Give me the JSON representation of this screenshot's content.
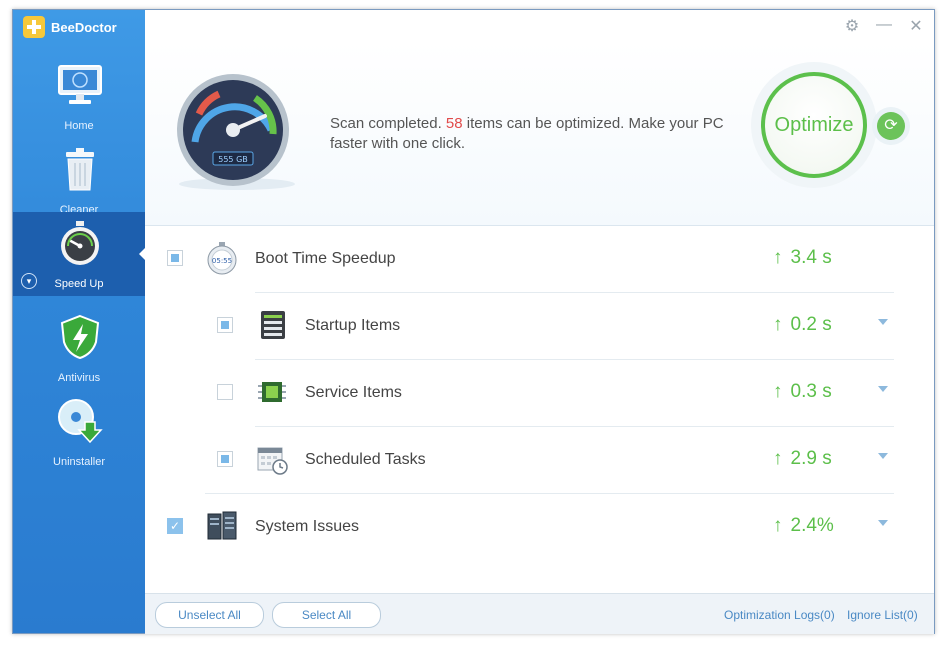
{
  "app": {
    "title": "BeeDoctor"
  },
  "titlebar": {
    "settings_icon": "gear-icon",
    "minimize_icon": "minimize-icon",
    "close_icon": "close-icon"
  },
  "sidebar": {
    "items": [
      {
        "label": "Home",
        "icon": "monitor-icon",
        "active": false
      },
      {
        "label": "Cleaner",
        "icon": "trash-icon",
        "active": false
      },
      {
        "label": "Speed Up",
        "icon": "stopwatch-icon",
        "active": true
      },
      {
        "label": "Antivirus",
        "icon": "shield-icon",
        "active": false
      },
      {
        "label": "Uninstaller",
        "icon": "disc-download-icon",
        "active": false
      }
    ]
  },
  "hero": {
    "gauge_label": "555 GB",
    "message_before": "Scan completed. ",
    "count": "58",
    "message_after": " items can be optimized. Make your PC faster with one click.",
    "optimize_label": "Optimize"
  },
  "rows": [
    {
      "label": "Boot Time Speedup",
      "value": "3.4 s",
      "check": "partial",
      "icon": "stopwatch-icon",
      "level": 0,
      "caret": false
    },
    {
      "label": "Startup Items",
      "value": "0.2 s",
      "check": "partial",
      "icon": "startup-list-icon",
      "level": 1,
      "caret": true
    },
    {
      "label": "Service Items",
      "value": "0.3 s",
      "check": "none",
      "icon": "chip-icon",
      "level": 1,
      "caret": true
    },
    {
      "label": "Scheduled Tasks",
      "value": "2.9 s",
      "check": "partial",
      "icon": "calendar-clock-icon",
      "level": 1,
      "caret": true
    },
    {
      "label": "System Issues",
      "value": "2.4%",
      "check": "checked",
      "icon": "server-icon",
      "level": 0,
      "caret": true
    }
  ],
  "footer": {
    "unselect_all": "Unselect All",
    "select_all": "Select All",
    "optimization_logs": "Optimization Logs(0)",
    "ignore_list": "Ignore List(0)"
  },
  "colors": {
    "accent": "#5cbf4a",
    "sidebar": "#2f86d8",
    "sidebar_active": "#1d5fae",
    "highlight": "#e14b4b",
    "link": "#4a89c4"
  }
}
